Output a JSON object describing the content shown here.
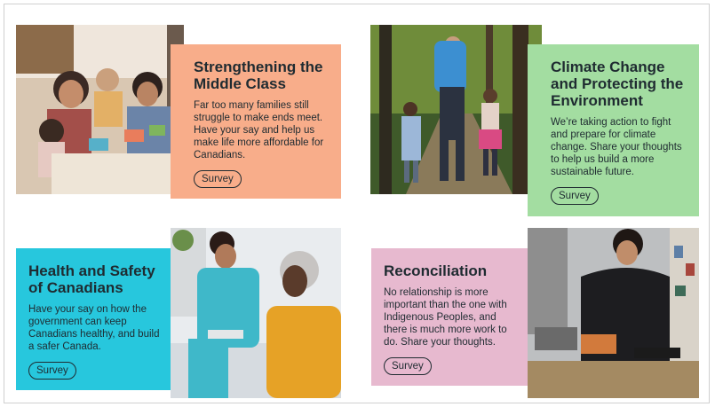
{
  "cards": [
    {
      "title": "Strengthening the Middle Class",
      "body": "Far too many families still struggle to make ends meet. Have your say and help us make life more affordable for Canadians.",
      "button": "Survey",
      "color": "#f8ad8a",
      "image": "family-playing-with-toys-photo"
    },
    {
      "title": "Climate Change and Protecting the Environment",
      "body": "We’re taking action to fight and prepare for climate change. Share your thoughts to help us build a more sustainable future.",
      "button": "Survey",
      "color": "#a3dda1",
      "image": "family-hiking-in-forest-photo"
    },
    {
      "title": "Health and Safety of Canadians",
      "body": "Have your say on how the government can keep Canadians healthy, and build a safer Canada.",
      "button": "Survey",
      "color": "#27c7dd",
      "image": "nurse-with-patient-photo"
    },
    {
      "title": "Reconciliation",
      "body": "No relationship is more important than the one with Indigenous Peoples, and there is much more work to do. Share your thoughts.",
      "button": "Survey",
      "color": "#e7b9cf",
      "image": "woman-cooking-food-photo"
    }
  ]
}
